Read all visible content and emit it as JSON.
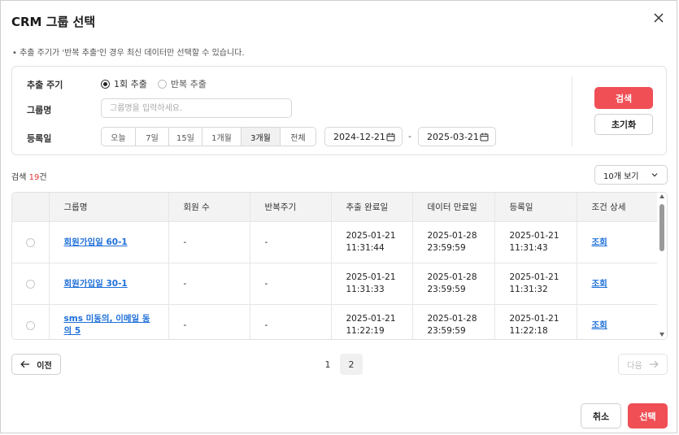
{
  "modal": {
    "title": "CRM 그룹 선택",
    "notice": "•  추출 주기가 '반복 추출'인 경우 최신 데이터만 선택할 수 있습니다."
  },
  "filter": {
    "cycle_label": "추출 주기",
    "cycle_options": [
      "1회 추출",
      "반복 추출"
    ],
    "cycle_selected": "1회 추출",
    "group_label": "그룹명",
    "group_placeholder": "그룹명을 입력하세요.",
    "group_value": "",
    "date_label": "등록일",
    "date_ranges": [
      "오늘",
      "7일",
      "15일",
      "1개월",
      "3개월",
      "전체"
    ],
    "date_range_selected": "3개월",
    "date_from": "2024-12-21",
    "date_separator": "-",
    "date_to": "2025-03-21",
    "search_button": "검색",
    "reset_button": "초기화"
  },
  "results": {
    "count_prefix": "검색 ",
    "count": "19",
    "count_suffix": "건",
    "page_size": "10개 보기"
  },
  "table": {
    "headers": [
      "",
      "그룹명",
      "회원 수",
      "반복주기",
      "추출 완료일",
      "데이터 만료일",
      "등록일",
      "조건 상세"
    ],
    "rows": [
      {
        "name": "회원가입일 60-1",
        "members": "-",
        "cycle": "-",
        "extract_date": "2025-01-21",
        "extract_time": "11:31:44",
        "expire_date": "2025-01-28",
        "expire_time": "23:59:59",
        "reg_date": "2025-01-21",
        "reg_time": "11:31:43",
        "detail": "조회"
      },
      {
        "name": "회원가입일 30-1",
        "members": "-",
        "cycle": "-",
        "extract_date": "2025-01-21",
        "extract_time": "11:31:33",
        "expire_date": "2025-01-28",
        "expire_time": "23:59:59",
        "reg_date": "2025-01-21",
        "reg_time": "11:31:32",
        "detail": "조회"
      },
      {
        "name": "sms 미동의, 이메일 동의 5",
        "members": "-",
        "cycle": "-",
        "extract_date": "2025-01-21",
        "extract_time": "11:22:19",
        "expire_date": "2025-01-28",
        "expire_time": "23:59:59",
        "reg_date": "2025-01-21",
        "reg_time": "11:22:18",
        "detail": "조회"
      }
    ]
  },
  "pagination": {
    "prev": "이전",
    "next": "다음",
    "pages": [
      "1",
      "2"
    ],
    "current": "2"
  },
  "footer": {
    "cancel": "취소",
    "select": "선택"
  },
  "colors": {
    "accent": "#ef4f55",
    "link": "#1e6fd9"
  }
}
